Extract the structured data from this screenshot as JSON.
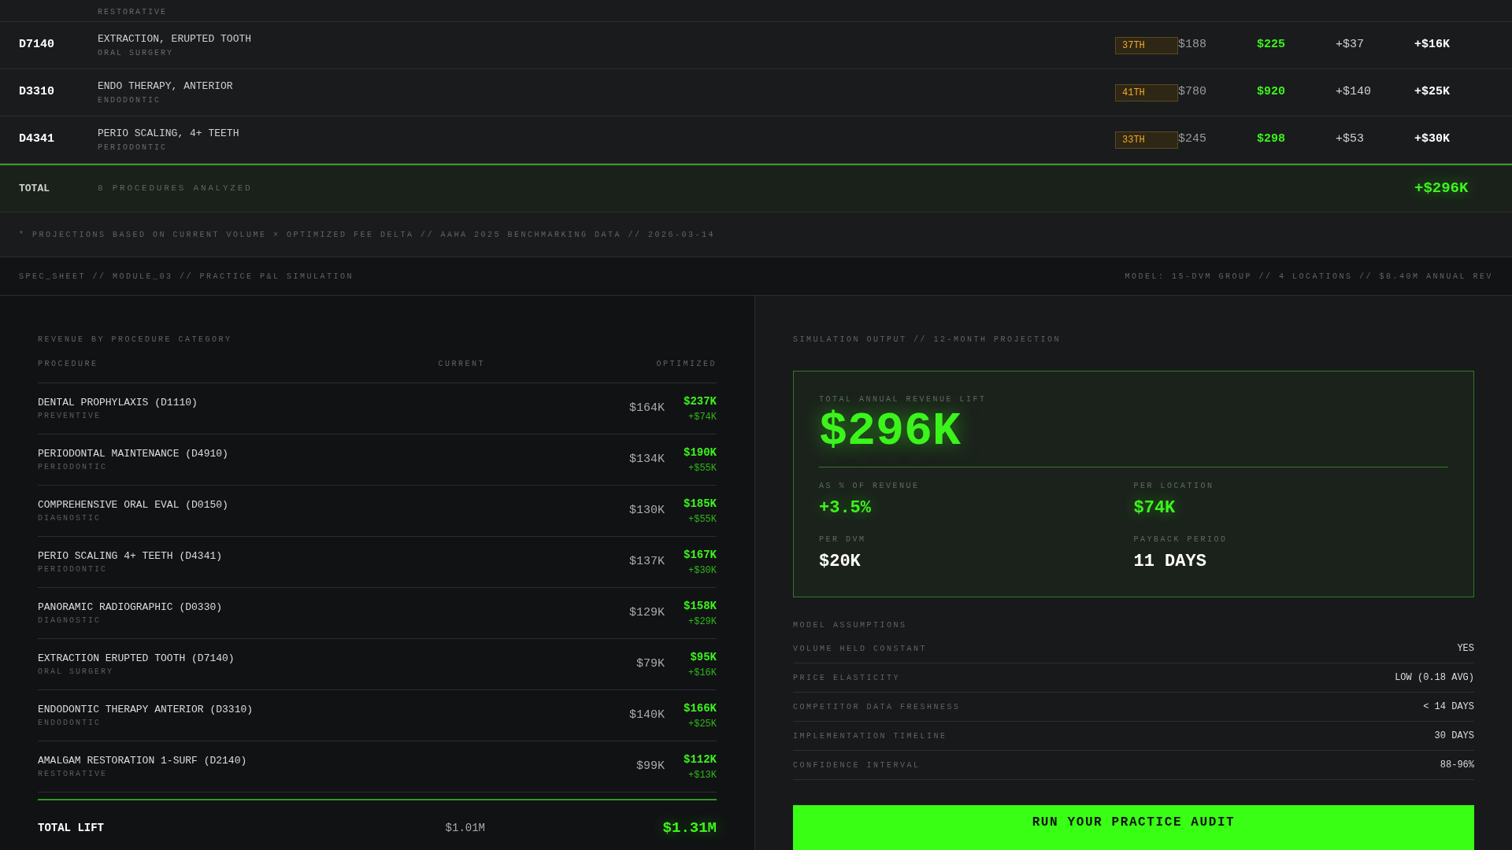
{
  "fee_table": {
    "partial_row": {
      "category": "RESTORATIVE"
    },
    "rows": [
      {
        "code": "D7140",
        "name": "EXTRACTION, ERUPTED TOOTH",
        "category": "ORAL SURGERY",
        "percentile": "37TH",
        "current": "$188",
        "optimized": "$225",
        "delta": "+$37",
        "annual": "+$16K"
      },
      {
        "code": "D3310",
        "name": "ENDO THERAPY, ANTERIOR",
        "category": "ENDODONTIC",
        "percentile": "41TH",
        "current": "$780",
        "optimized": "$920",
        "delta": "+$140",
        "annual": "+$25K"
      },
      {
        "code": "D4341",
        "name": "PERIO SCALING, 4+ TEETH",
        "category": "PERIODONTIC",
        "percentile": "33TH",
        "current": "$245",
        "optimized": "$298",
        "delta": "+$53",
        "annual": "+$30K"
      }
    ],
    "total": {
      "label": "TOTAL",
      "note": "8 PROCEDURES ANALYZED",
      "value": "+$296K"
    },
    "footnote": "* PROJECTIONS BASED ON CURRENT VOLUME × OPTIMIZED FEE DELTA // AAHA 2025 BENCHMARKING DATA // 2026-03-14"
  },
  "spec_bar": {
    "left": "SPEC_SHEET // MODULE_03 // PRACTICE P&L SIMULATION",
    "right": "MODEL: 15-DVM GROUP // 4 LOCATIONS // $8.40M ANNUAL REV"
  },
  "revenue": {
    "title": "REVENUE BY PROCEDURE CATEGORY",
    "columns": [
      "PROCEDURE",
      "CURRENT",
      "OPTIMIZED"
    ],
    "rows": [
      {
        "name": "DENTAL PROPHYLAXIS (D1110)",
        "category": "PREVENTIVE",
        "current": "$164K",
        "optimized": "$237K",
        "lift": "+$74K"
      },
      {
        "name": "PERIODONTAL MAINTENANCE (D4910)",
        "category": "PERIODONTIC",
        "current": "$134K",
        "optimized": "$190K",
        "lift": "+$55K"
      },
      {
        "name": "COMPREHENSIVE ORAL EVAL (D0150)",
        "category": "DIAGNOSTIC",
        "current": "$130K",
        "optimized": "$185K",
        "lift": "+$55K"
      },
      {
        "name": "PERIO SCALING 4+ TEETH (D4341)",
        "category": "PERIODONTIC",
        "current": "$137K",
        "optimized": "$167K",
        "lift": "+$30K"
      },
      {
        "name": "PANORAMIC RADIOGRAPHIC (D0330)",
        "category": "DIAGNOSTIC",
        "current": "$129K",
        "optimized": "$158K",
        "lift": "+$29K"
      },
      {
        "name": "EXTRACTION ERUPTED TOOTH (D7140)",
        "category": "ORAL SURGERY",
        "current": "$79K",
        "optimized": "$95K",
        "lift": "+$16K"
      },
      {
        "name": "ENDODONTIC THERAPY ANTERIOR (D3310)",
        "category": "ENDODONTIC",
        "current": "$140K",
        "optimized": "$166K",
        "lift": "+$25K"
      },
      {
        "name": "AMALGAM RESTORATION 1-SURF (D2140)",
        "category": "RESTORATIVE",
        "current": "$99K",
        "optimized": "$112K",
        "lift": "+$13K"
      }
    ],
    "total": {
      "label": "TOTAL LIFT",
      "current": "$1.01M",
      "optimized": "$1.31M"
    }
  },
  "simulation": {
    "title": "SIMULATION OUTPUT // 12-MONTH PROJECTION",
    "headline": {
      "label": "TOTAL ANNUAL REVENUE LIFT",
      "value": "$296K"
    },
    "stats": [
      {
        "label": "AS % OF REVENUE",
        "value": "+3.5%",
        "kind": "accent"
      },
      {
        "label": "PER LOCATION",
        "value": "$74K",
        "kind": "accent"
      },
      {
        "label": "PER DVM",
        "value": "$20K",
        "kind": "plain"
      },
      {
        "label": "PAYBACK PERIOD",
        "value": "11 DAYS",
        "kind": "plain"
      }
    ],
    "assumptions_title": "MODEL ASSUMPTIONS",
    "assumptions": [
      {
        "label": "VOLUME HELD CONSTANT",
        "value": "YES"
      },
      {
        "label": "PRICE ELASTICITY",
        "value": "LOW (0.18 AVG)"
      },
      {
        "label": "COMPETITOR DATA FRESHNESS",
        "value": "< 14 DAYS"
      },
      {
        "label": "IMPLEMENTATION TIMELINE",
        "value": "30 DAYS"
      },
      {
        "label": "CONFIDENCE INTERVAL",
        "value": "88-96%"
      }
    ],
    "cta": "RUN YOUR PRACTICE AUDIT"
  }
}
